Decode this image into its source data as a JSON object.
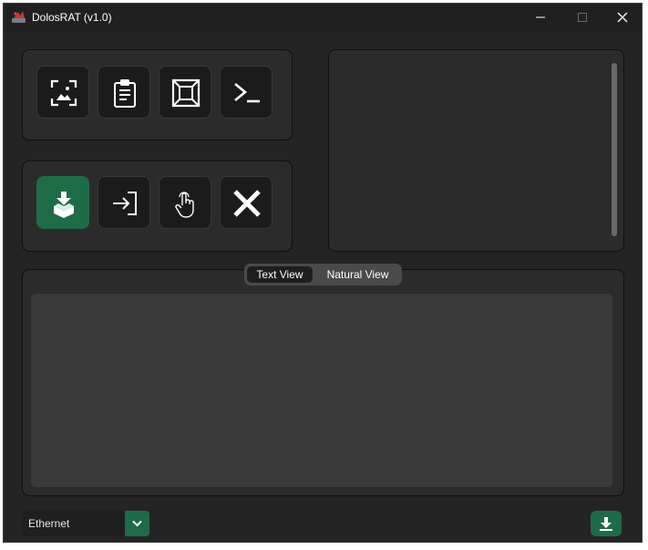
{
  "window": {
    "title": "DolosRAT (v1.0)"
  },
  "toolbar_top": {
    "buttons": [
      "screenshot-icon",
      "clipboard-icon",
      "fullscreen-icon",
      "terminal-icon"
    ]
  },
  "toolbar_bottom": {
    "buttons": [
      "download-box-icon",
      "login-arrow-icon",
      "touch-hand-icon",
      "close-x-icon"
    ]
  },
  "view_switch": {
    "options": [
      "Text View",
      "Natural View"
    ],
    "selected": "Text View"
  },
  "footer": {
    "interface_select_value": "Ethernet"
  },
  "colors": {
    "accent": "#1e6b48",
    "background": "#242424",
    "panel": "#2b2b2b"
  }
}
